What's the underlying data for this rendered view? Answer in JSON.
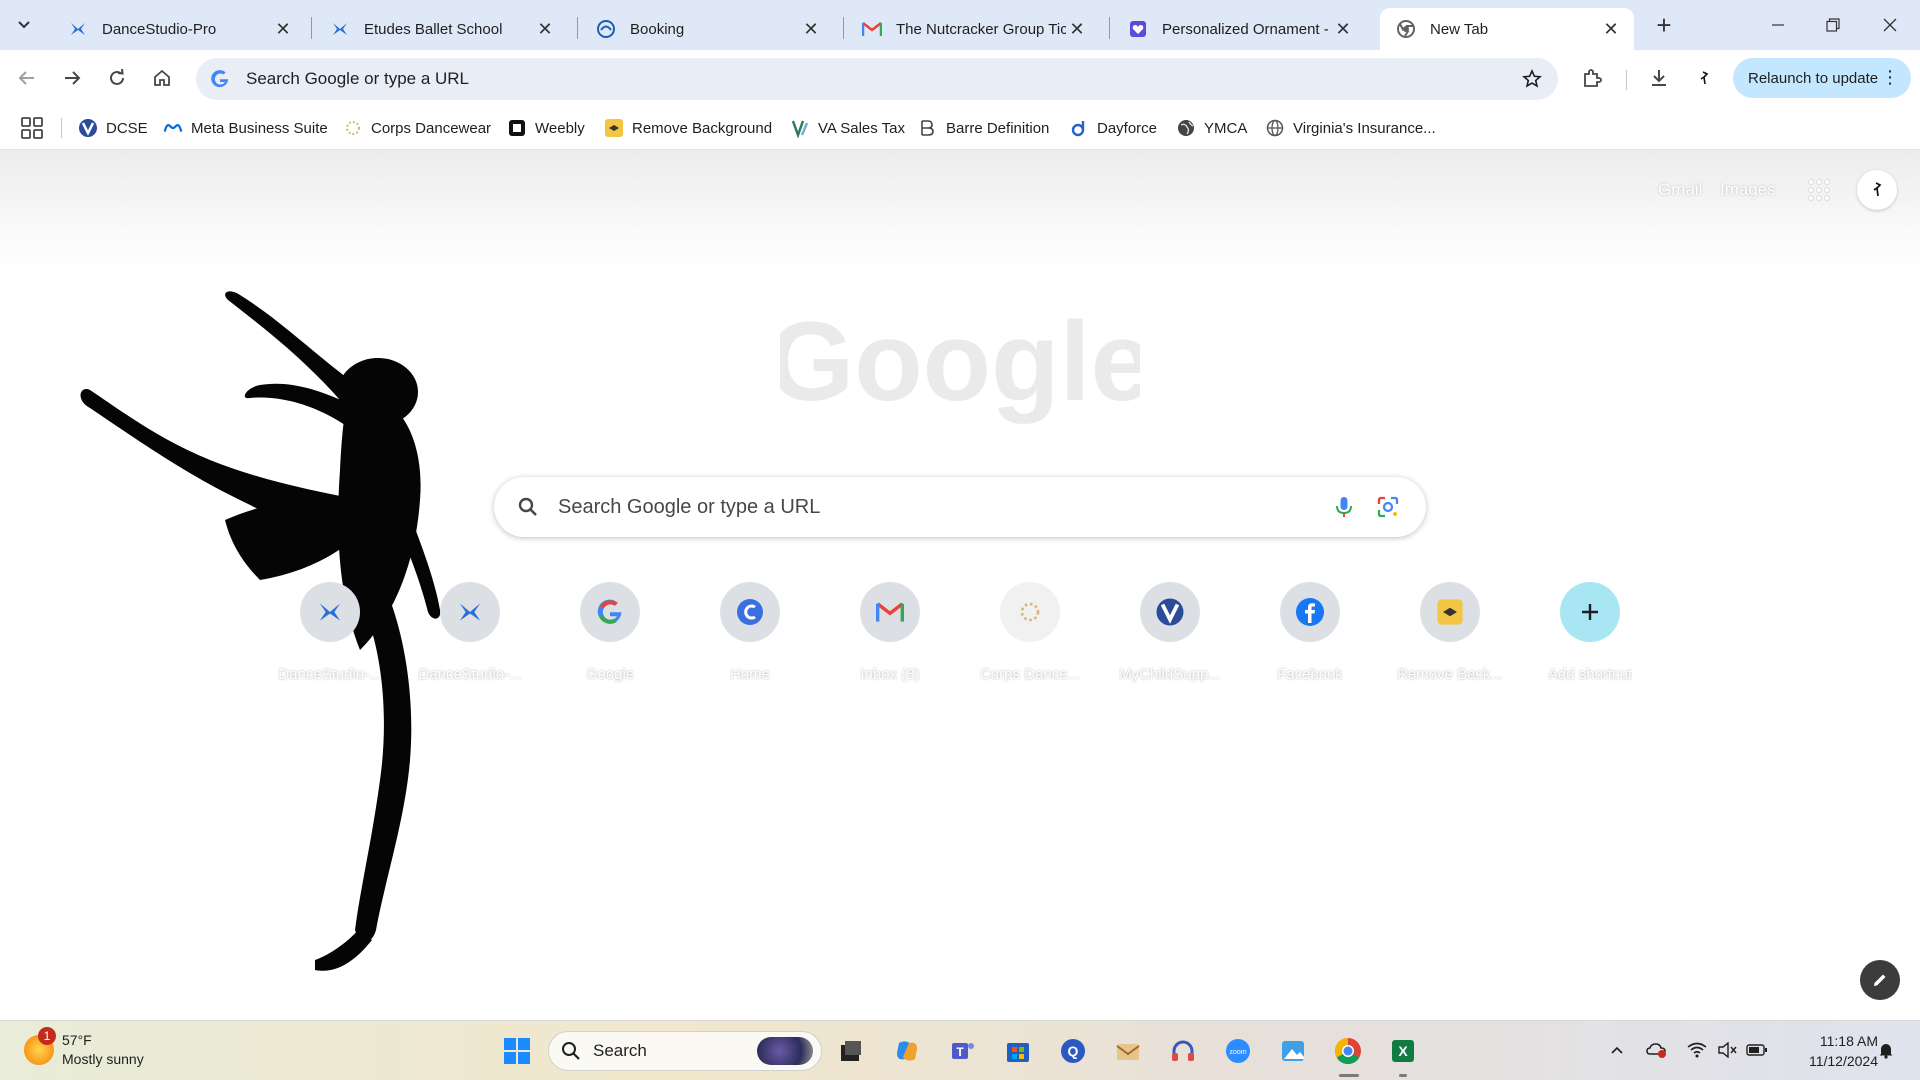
{
  "tabs": [
    {
      "title": "DanceStudio-Pro",
      "active": false,
      "icon": "dancestudio-icon"
    },
    {
      "title": "Etudes Ballet School",
      "active": false,
      "icon": "dancestudio-icon"
    },
    {
      "title": "Booking",
      "active": false,
      "icon": "booking-icon"
    },
    {
      "title": "The Nutcracker Group Tick",
      "active": false,
      "icon": "gmail-icon"
    },
    {
      "title": "Personalized Ornament - Ir",
      "active": false,
      "icon": "heart-icon"
    },
    {
      "title": "New Tab",
      "active": true,
      "icon": "chrome-icon"
    }
  ],
  "toolbar": {
    "omnibox_placeholder": "Search Google or type a URL",
    "relaunch_label": "Relaunch to update"
  },
  "bookmarks": [
    {
      "label": "DCSE",
      "icon": "v-logo-icon"
    },
    {
      "label": "Meta Business Suite",
      "icon": "meta-icon"
    },
    {
      "label": "Corps Dancewear",
      "icon": "corps-icon"
    },
    {
      "label": "Weebly",
      "icon": "weebly-icon"
    },
    {
      "label": "Remove Background",
      "icon": "removebg-icon"
    },
    {
      "label": "VA Sales Tax",
      "icon": "va-tax-icon"
    },
    {
      "label": "Barre Definition",
      "icon": "barre-icon"
    },
    {
      "label": "Dayforce",
      "icon": "dayforce-icon"
    },
    {
      "label": "YMCA",
      "icon": "globe-icon"
    },
    {
      "label": "Virginia's Insurance...",
      "icon": "globe-icon"
    }
  ],
  "ntp": {
    "gmail_link": "Gmail",
    "images_link": "Images",
    "logo_text": "Google",
    "search_placeholder": "Search Google or type a URL",
    "shortcuts": [
      {
        "label": "DanceStudio-...",
        "icon": "dancestudio-icon"
      },
      {
        "label": "DanceStudio-...",
        "icon": "dancestudio-icon"
      },
      {
        "label": "Google",
        "icon": "google-icon"
      },
      {
        "label": "Home",
        "icon": "home-c-icon"
      },
      {
        "label": "Inbox (8)",
        "icon": "gmail-icon"
      },
      {
        "label": "Corps Dance...",
        "icon": "corps-icon"
      },
      {
        "label": "MyChildSupp...",
        "icon": "v-logo-icon"
      },
      {
        "label": "Facebook",
        "icon": "facebook-icon"
      },
      {
        "label": "Remove Back...",
        "icon": "removebg-icon"
      },
      {
        "label": "Add shortcut",
        "icon": "plus-icon"
      }
    ]
  },
  "taskbar": {
    "weather_temp": "57°F",
    "weather_desc": "Mostly sunny",
    "weather_badge": "1",
    "search_label": "Search",
    "time": "11:18 AM",
    "date": "11/12/2024"
  },
  "colors": {
    "tabstrip_bg": "#dfe8f6",
    "omnibox_bg": "#e9eef6",
    "relaunch_bg": "#c2e7ff",
    "add_shortcut_bg": "#a8e6f4"
  }
}
